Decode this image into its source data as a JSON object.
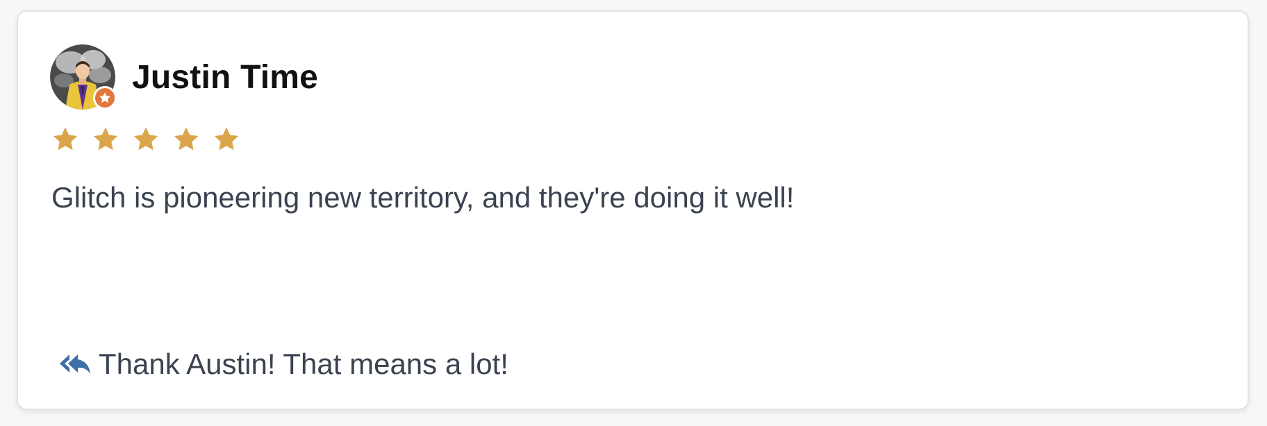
{
  "review": {
    "reviewer_name": "Justin Time",
    "rating": 5,
    "rating_max": 5,
    "text": "Glitch is pioneering new territory, and they're doing it well!",
    "reply_text": "Thank Austin! That means a lot!"
  },
  "icons": {
    "avatar_badge": "star-badge-icon",
    "rating_star": "star-icon",
    "reply": "reply-all-icon"
  },
  "colors": {
    "star": "#dba54b",
    "badge": "#e2763c",
    "reply_icon": "#3f6ea8",
    "name": "#111111",
    "body_text": "#3a4250"
  }
}
